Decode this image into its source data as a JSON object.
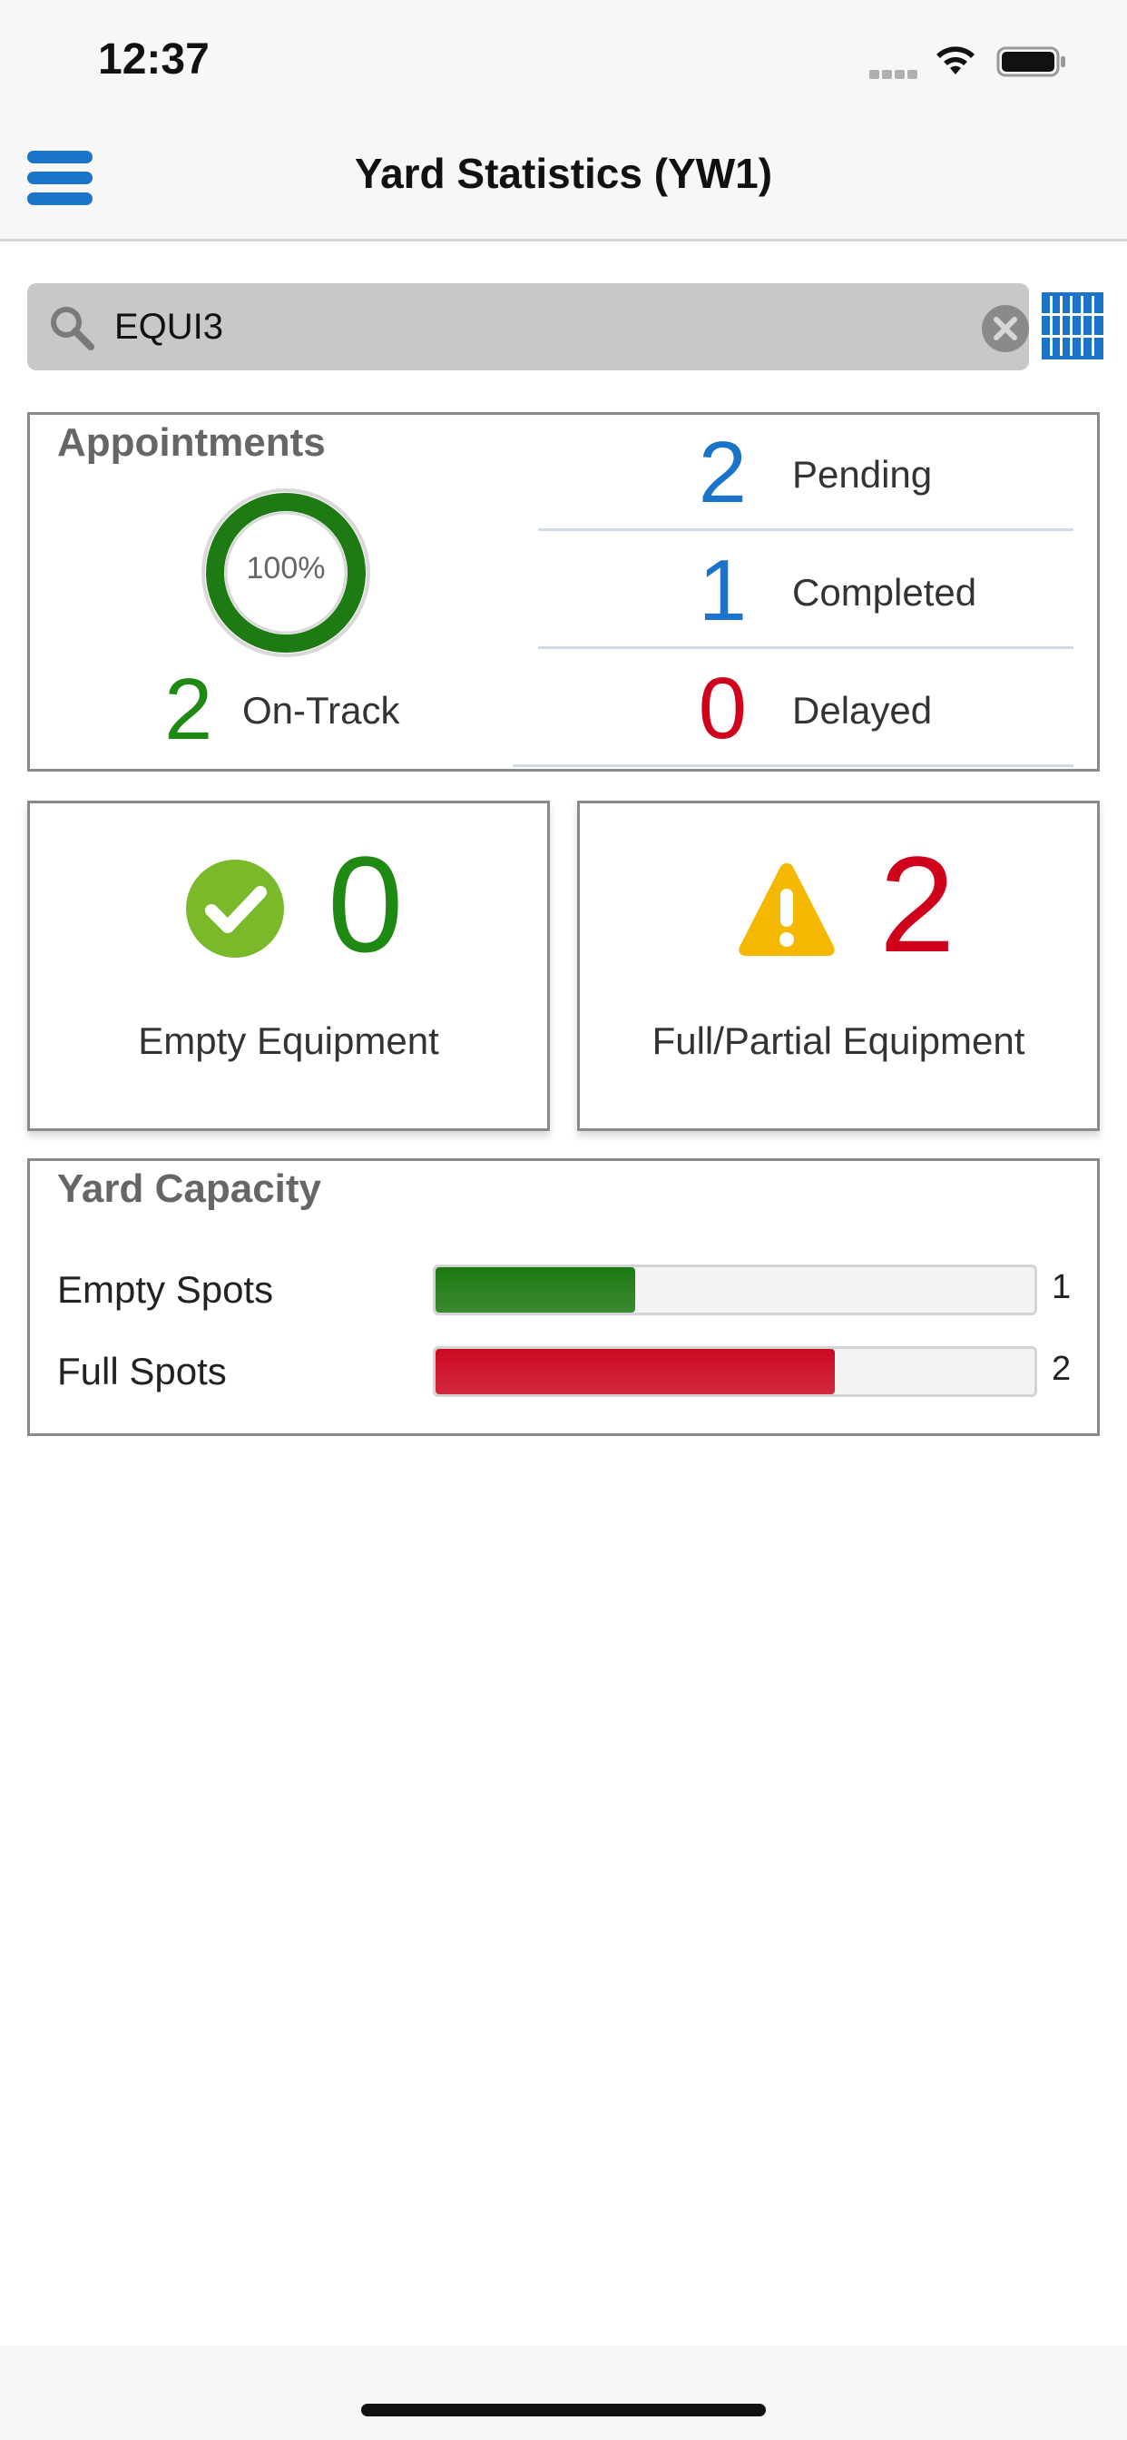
{
  "status_bar": {
    "time": "12:37"
  },
  "nav": {
    "title": "Yard Statistics (YW1)"
  },
  "search": {
    "value": "EQUI3",
    "placeholder": ""
  },
  "appointments": {
    "title": "Appointments",
    "completion_percent": 100,
    "completion_label": "100%",
    "on_track": {
      "count": "2",
      "label": "On-Track"
    },
    "stats": [
      {
        "count": "2",
        "label": "Pending",
        "color": "#1b74c9"
      },
      {
        "count": "1",
        "label": "Completed",
        "color": "#1b74c9"
      },
      {
        "count": "0",
        "label": "Delayed",
        "color": "#d0021b"
      }
    ]
  },
  "equipment": {
    "empty": {
      "count": "0",
      "label": "Empty Equipment",
      "icon": "check-circle-icon",
      "color": "#1e8a14"
    },
    "full": {
      "count": "2",
      "label": "Full/Partial Equipment",
      "icon": "warning-icon",
      "color": "#d0021b"
    }
  },
  "capacity": {
    "title": "Yard Capacity",
    "max": 3,
    "rows": [
      {
        "label": "Empty Spots",
        "value": 1,
        "value_text": "1",
        "color": "#1e7a12"
      },
      {
        "label": "Full Spots",
        "value": 2,
        "value_text": "2",
        "color": "#cc0a22"
      }
    ]
  },
  "colors": {
    "accent": "#1b74c9",
    "success": "#1e8a14",
    "danger": "#d0021b",
    "warning": "#f5b800"
  }
}
